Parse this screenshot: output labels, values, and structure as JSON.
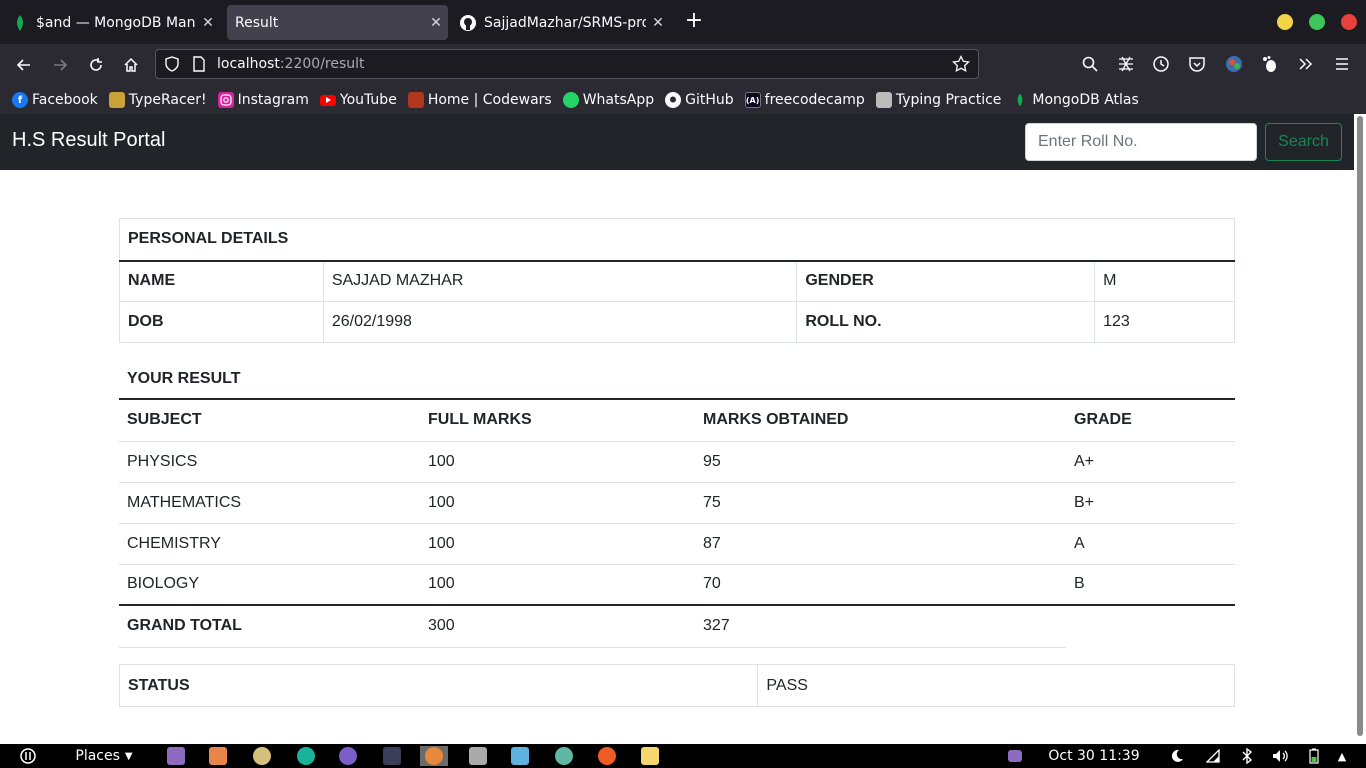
{
  "browser": {
    "tabs": [
      {
        "title": "$and — MongoDB Manual",
        "active": false
      },
      {
        "title": "Result",
        "active": true
      },
      {
        "title": "SajjadMazhar/SRMS-protot",
        "active": false
      }
    ],
    "url_host": "localhost",
    "url_rest": ":2200/result",
    "bookmarks": [
      {
        "label": "Facebook",
        "icon": "facebook-icon"
      },
      {
        "label": "TypeRacer!",
        "icon": "typeracer-icon"
      },
      {
        "label": "Instagram",
        "icon": "instagram-icon"
      },
      {
        "label": "YouTube",
        "icon": "youtube-icon"
      },
      {
        "label": "Home | Codewars",
        "icon": "codewars-icon"
      },
      {
        "label": "WhatsApp",
        "icon": "whatsapp-icon"
      },
      {
        "label": "GitHub",
        "icon": "github-icon"
      },
      {
        "label": "freecodecamp",
        "icon": "freecodecamp-icon"
      },
      {
        "label": "Typing Practice",
        "icon": "typing-icon"
      },
      {
        "label": "MongoDB Atlas",
        "icon": "mongodb-leaf-icon"
      }
    ]
  },
  "site": {
    "brand": "H.S Result Portal",
    "search_placeholder": "Enter Roll No.",
    "search_button": "Search"
  },
  "personal": {
    "heading": "PERSONAL DETAILS",
    "name_label": "NAME",
    "name": "SAJJAD MAZHAR",
    "gender_label": "GENDER",
    "gender": "M",
    "dob_label": "DOB",
    "dob": "26/02/1998",
    "roll_label": "ROLL NO.",
    "roll": "123"
  },
  "result": {
    "heading": "YOUR RESULT",
    "columns": [
      "SUBJECT",
      "FULL MARKS",
      "MARKS OBTAINED",
      "GRADE"
    ],
    "rows": [
      {
        "subject": "PHYSICS",
        "full": "100",
        "obtained": "95",
        "grade": "A+"
      },
      {
        "subject": "MATHEMATICS",
        "full": "100",
        "obtained": "75",
        "grade": "B+"
      },
      {
        "subject": "CHEMISTRY",
        "full": "100",
        "obtained": "87",
        "grade": "A"
      },
      {
        "subject": "BIOLOGY",
        "full": "100",
        "obtained": "70",
        "grade": "B"
      }
    ],
    "total_label": "GRAND TOTAL",
    "total_full": "300",
    "total_obtained": "327"
  },
  "status": {
    "label": "STATUS",
    "value": "PASS"
  },
  "taskbar": {
    "places": "Places",
    "clock": "Oct 30  11:39"
  },
  "colors": {
    "site_header": "#212529",
    "search_button": "#198754",
    "browser_chrome": "#2b2a33",
    "tabstrip": "#1c1b22"
  }
}
